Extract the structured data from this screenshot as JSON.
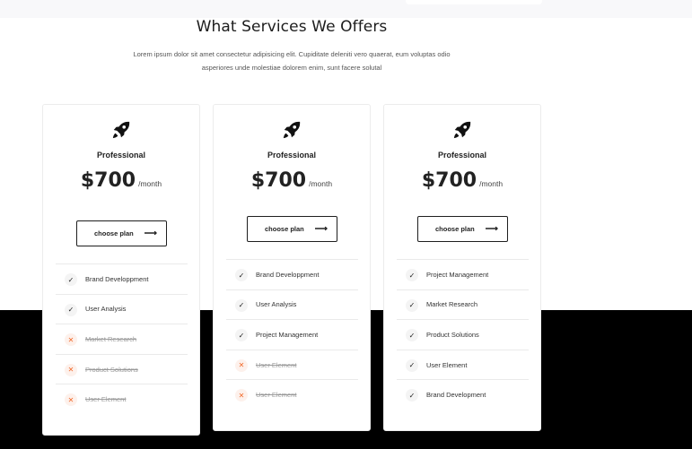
{
  "section": {
    "title": "What Services We Offers",
    "description_line1": "Lorem ipsum dolor sit amet consectetur adipisicing elit. Cupiditate deleniti vero quaerat, eum voluptas odio",
    "description_line2": "asperiores unde molestiae dolorem enim, sunt facere solutal"
  },
  "cards": [
    {
      "name": "Professional",
      "price": "$700",
      "period": "/month",
      "button_label": "choose plan",
      "features": [
        {
          "label": "Brand Developpment",
          "included": true
        },
        {
          "label": "User Analysis",
          "included": true
        },
        {
          "label": "Market Research",
          "included": false
        },
        {
          "label": "Product Solutions",
          "included": false
        },
        {
          "label": "User Element",
          "included": false
        }
      ]
    },
    {
      "name": "Professional",
      "price": "$700",
      "period": "/month",
      "button_label": "choose plan",
      "features": [
        {
          "label": "Brand Developpment",
          "included": true
        },
        {
          "label": "User Analysis",
          "included": true
        },
        {
          "label": "Project Management",
          "included": true
        },
        {
          "label": "User Element",
          "included": false
        },
        {
          "label": "User Element",
          "included": false
        }
      ]
    },
    {
      "name": "Professional",
      "price": "$700",
      "period": "/month",
      "button_label": "choose plan",
      "features": [
        {
          "label": "Project Management",
          "included": true
        },
        {
          "label": "Market Research",
          "included": true
        },
        {
          "label": "Product Solutions",
          "included": true
        },
        {
          "label": "User Element",
          "included": true
        },
        {
          "label": "Brand Development",
          "included": true
        }
      ]
    }
  ],
  "icons": {
    "plan_icon": "rocket-icon",
    "included_icon": "check-icon",
    "excluded_icon": "close-icon",
    "button_icon": "arrow-right-icon"
  },
  "colors": {
    "excluded_accent": "#f26a2a",
    "band": "#000000",
    "button_border": "#1e1e1e"
  }
}
